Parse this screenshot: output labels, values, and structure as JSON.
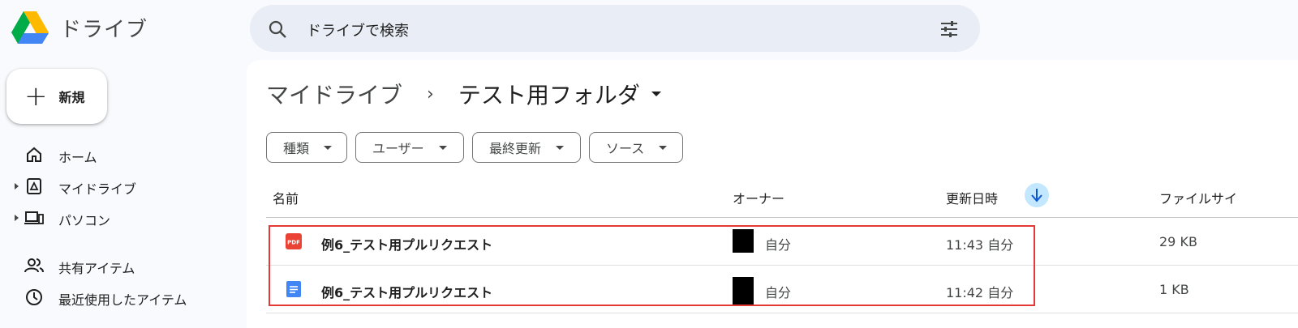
{
  "app": {
    "title": "ドライブ"
  },
  "search": {
    "placeholder": "ドライブで検索"
  },
  "new_button": {
    "label": "新規"
  },
  "sidebar": {
    "items": [
      {
        "label": "ホーム",
        "icon": "home-icon"
      },
      {
        "label": "マイドライブ",
        "icon": "my-drive-icon"
      },
      {
        "label": "パソコン",
        "icon": "computer-icon"
      },
      {
        "label": "共有アイテム",
        "icon": "shared-icon"
      },
      {
        "label": "最近使用したアイテム",
        "icon": "clock-icon"
      }
    ]
  },
  "breadcrumb": {
    "root": "マイドライブ",
    "separator": "›",
    "current": "テスト用フォルダ"
  },
  "filters": [
    "種類",
    "ユーザー",
    "最終更新",
    "ソース"
  ],
  "table": {
    "headers": {
      "name": "名前",
      "owner": "オーナー",
      "modified": "更新日時",
      "size": "ファイルサイ"
    },
    "sort_icon": "arrow-down-icon",
    "rows": [
      {
        "icon": "pdf-icon",
        "icon_text": "PDF",
        "name": "例6_テスト用プルリクエスト",
        "owner": "自分",
        "modified": "11:43 自分",
        "size": "29 KB"
      },
      {
        "icon": "google-doc-icon",
        "name": "例6_テスト用プルリクエスト",
        "owner": "自分",
        "modified": "11:42 自分",
        "size": "1 KB"
      }
    ]
  },
  "colors": {
    "highlight": "#e53935",
    "sort_badge": "#c2e7ff",
    "pdf": "#ea4335",
    "doc": "#4285f4"
  }
}
